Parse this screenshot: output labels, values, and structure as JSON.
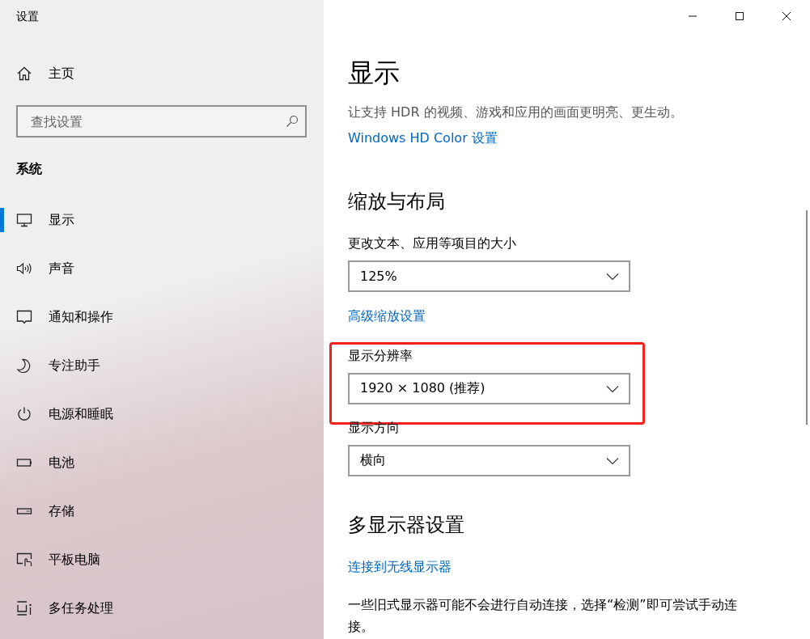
{
  "window": {
    "title": "设置"
  },
  "sidebar": {
    "home": {
      "label": "主页"
    },
    "search": {
      "placeholder": "查找设置"
    },
    "section": "系统",
    "items": [
      {
        "label": "显示",
        "selected": true
      },
      {
        "label": "声音",
        "selected": false
      },
      {
        "label": "通知和操作",
        "selected": false
      },
      {
        "label": "专注助手",
        "selected": false
      },
      {
        "label": "电源和睡眠",
        "selected": false
      },
      {
        "label": "电池",
        "selected": false
      },
      {
        "label": "存储",
        "selected": false
      },
      {
        "label": "平板电脑",
        "selected": false
      },
      {
        "label": "多任务处理",
        "selected": false
      }
    ]
  },
  "main": {
    "title": "显示",
    "description": "让支持 HDR 的视频、游戏和应用的画面更明亮、更生动。",
    "description_link": "Windows HD Color 设置",
    "sections": [
      {
        "heading": "缩放与布局",
        "items": [
          {
            "kind": "dropdown",
            "label": "更改文本、应用等项目的大小",
            "value": "125%",
            "highlighted": false
          },
          {
            "kind": "link",
            "text": "高级缩放设置"
          },
          {
            "kind": "dropdown",
            "label": "显示分辨率",
            "value": "1920 × 1080 (推荐)",
            "highlighted": true
          },
          {
            "kind": "dropdown",
            "label": "显示方向",
            "value": "横向",
            "highlighted": false
          }
        ]
      },
      {
        "heading": "多显示器设置",
        "items": [
          {
            "kind": "link",
            "text": "连接到无线显示器"
          },
          {
            "kind": "paragraph",
            "text": "一些旧式显示器可能不会进行自动连接，选择“检测”即可尝试手动连接。"
          }
        ]
      }
    ]
  }
}
